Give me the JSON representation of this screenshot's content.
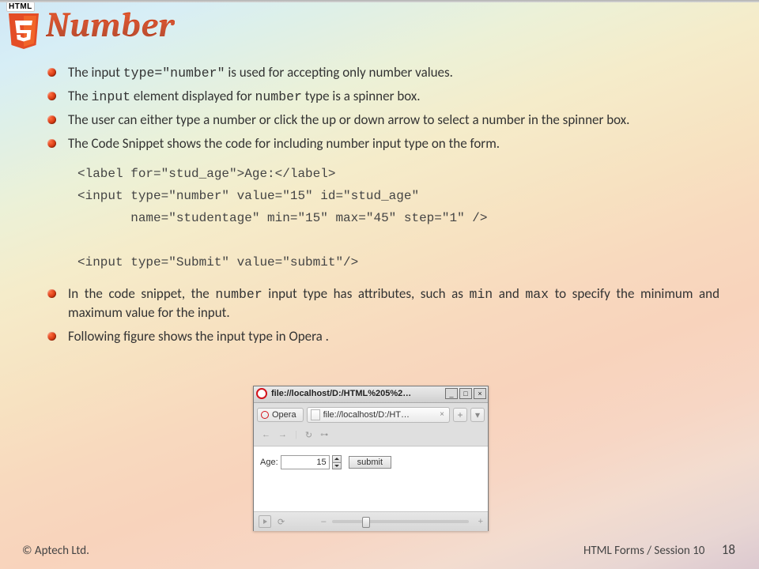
{
  "header": {
    "badge": "HTML",
    "title": "Number"
  },
  "bullets": {
    "b1_pre": "The input ",
    "b1_code": "type=\"number\"",
    "b1_post": " is used for accepting only number values.",
    "b2_pre": "The ",
    "b2_code1": "input",
    "b2_mid": " element displayed for ",
    "b2_code2": "number",
    "b2_post": " type is a spinner box.",
    "b3": "The user can either type a number or click the up or down arrow to select a number in the spinner box.",
    "b4": "The Code Snippet shows the code for including number input type on the form.",
    "b5_pre": "In the code snippet, the ",
    "b5_code1": "number",
    "b5_mid": " input type has attributes, such as ",
    "b5_code2": "min",
    "b5_and": " and ",
    "b5_code3": "max",
    "b5_post": " to specify the minimum and maximum value for the input.",
    "b6": "Following figure shows the input type in Opera ."
  },
  "code": {
    "line1": "<label for=\"stud_age\">Age:</label>",
    "line2": "<input type=\"number\" value=\"15\" id=\"stud_age\"",
    "line3": "       name=\"studentage\" min=\"15\" max=\"45\" step=\"1\" />",
    "line4": "<input type=\"Submit\" value=\"submit\"/>"
  },
  "opera": {
    "titlebar": "file://localhost/D:/HTML%205%2…",
    "badge": "Opera",
    "tab_label": "file://localhost/D:/HT…",
    "field_label": "Age:",
    "field_value": "15",
    "submit_label": "submit"
  },
  "footer": {
    "copyright": "© Aptech Ltd.",
    "session": "HTML Forms / Session 10",
    "page": "18"
  }
}
